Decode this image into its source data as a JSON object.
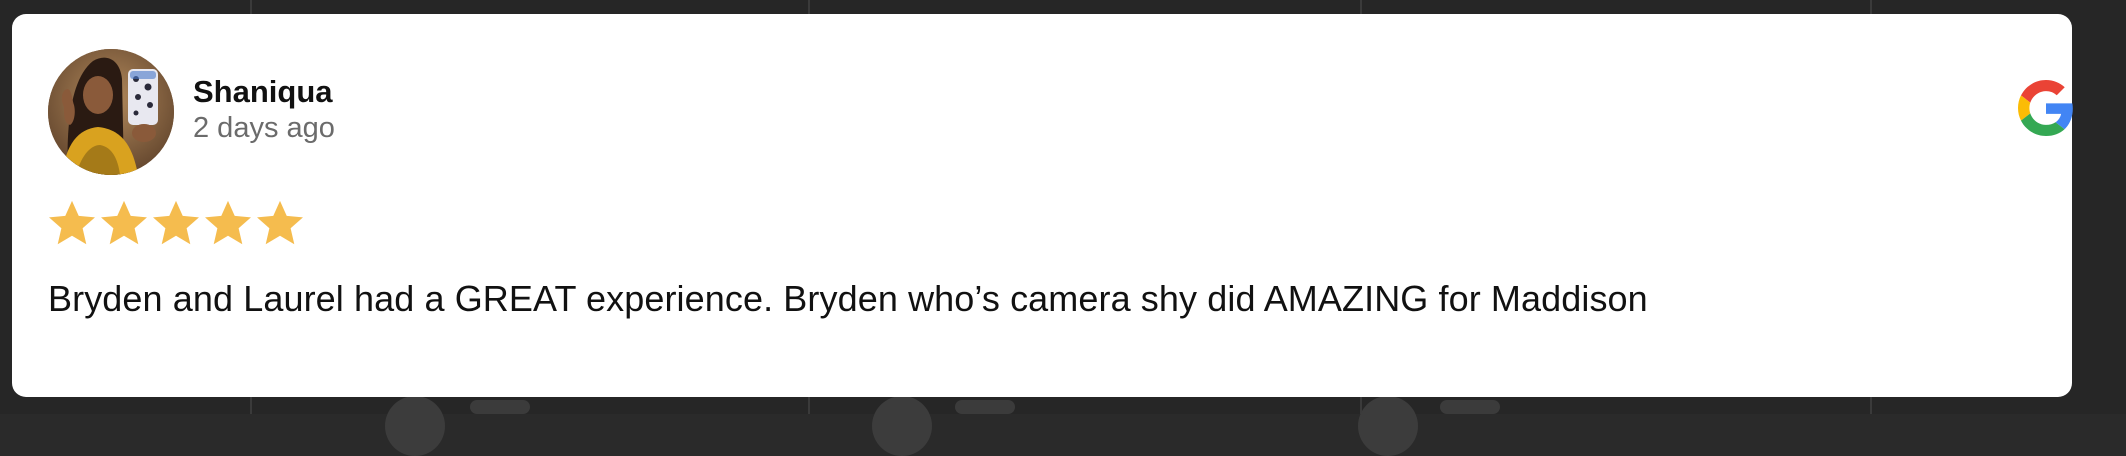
{
  "review": {
    "reviewer_name": "Shaniqua",
    "date": "2 days ago",
    "rating": 5,
    "rating_max": 5,
    "text": "Bryden and Laurel had a GREAT experience. Bryden who’s camera shy did AMAZING for Maddison",
    "source_icon": "google-icon",
    "avatar_icon": "user-avatar-photo"
  },
  "colors": {
    "star": "#F5BC4E",
    "card_bg": "#FFFFFF",
    "page_bg": "#262626",
    "name": "#111111",
    "date": "#6B6B6B",
    "google_blue": "#4285F4",
    "google_red": "#EA4335",
    "google_yellow": "#FBBC05",
    "google_green": "#34A853"
  }
}
